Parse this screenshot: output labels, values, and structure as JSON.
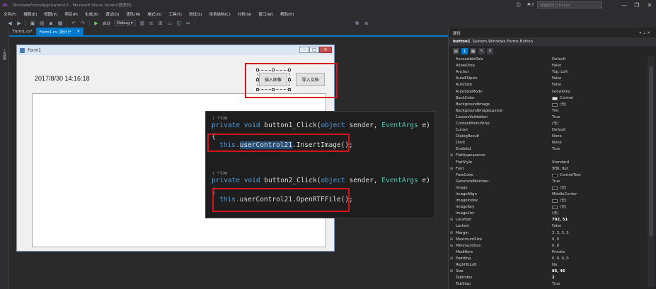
{
  "window": {
    "title": "WindowsFormsApplication13 - Microsoft Visual Studio(管理员)",
    "notify_count": "7",
    "quick_launch_placeholder": "快速启动 (Ctrl+Q)",
    "min": "—",
    "max": "❐",
    "close": "✕"
  },
  "menu": [
    "文件(F)",
    "编辑(E)",
    "视图(V)",
    "项目(P)",
    "生成(B)",
    "调试(D)",
    "团队(M)",
    "格式(O)",
    "工具(T)",
    "测试(S)",
    "体系结构(C)",
    "分析(N)",
    "窗口(W)",
    "帮助(H)"
  ],
  "toolbar": {
    "start_label": "启动",
    "config": "Debug"
  },
  "left_strip": "工具箱",
  "tabs": [
    {
      "label": "Form1.cs*",
      "active": false
    },
    {
      "label": "Form1.cs [设计]*",
      "active": true
    }
  ],
  "form": {
    "title": "Form1",
    "datetime": "2017/8/30 14:16:18",
    "btn_insert_image": "插入图像",
    "btn_import_doc": "导入文档"
  },
  "code": {
    "ref1": "1 个引用",
    "ref2": "1 个引用",
    "line1_kw": "private void",
    "line1_name": " button1_Click(",
    "line1_p1": "object",
    "line1_sender": " sender, ",
    "line1_p2": "EventArgs",
    "line1_end": " e)",
    "brace": "{",
    "l2_this": "this.",
    "l2_ctl": "userControl21",
    "l2_call": ".InsertImage();",
    "line3_kw": "private void",
    "line3_name": " button2_Click(",
    "line3_p1": "object",
    "line3_sender": " sender, ",
    "line3_p2": "EventArgs",
    "line3_end": " e)",
    "l4_this": "this.",
    "l4_ctl": "userControl21",
    "l4_call": ".OpenRTFFile();"
  },
  "properties": {
    "header": "属性",
    "object_name": "button1",
    "object_type": "System.Windows.Forms.Button",
    "rows": [
      {
        "name": "AccessibleRole",
        "value": "Default"
      },
      {
        "name": "AllowDrop",
        "value": "False"
      },
      {
        "name": "Anchor",
        "value": "Top, Left"
      },
      {
        "name": "AutoEllipsis",
        "value": "False"
      },
      {
        "name": "AutoSize",
        "value": "False"
      },
      {
        "name": "AutoSizeMode",
        "value": "GrowOnly"
      },
      {
        "name": "BackColor",
        "value": "Control",
        "swatch": "#f0f0f0"
      },
      {
        "name": "BackgroundImage",
        "value": "(无)",
        "swatch": "#1e1e1e"
      },
      {
        "name": "BackgroundImageLayout",
        "value": "Tile"
      },
      {
        "name": "CausesValidation",
        "value": "True"
      },
      {
        "name": "ContextMenuStrip",
        "value": "(无)"
      },
      {
        "name": "Cursor",
        "value": "Default"
      },
      {
        "name": "DialogResult",
        "value": "None"
      },
      {
        "name": "Dock",
        "value": "None"
      },
      {
        "name": "Enabled",
        "value": "True"
      },
      {
        "name": "FlatAppearance",
        "value": "",
        "exp": "⊞"
      },
      {
        "name": "FlatStyle",
        "value": "Standard"
      },
      {
        "name": "Font",
        "value": "宋体, 9pt",
        "exp": "⊞"
      },
      {
        "name": "ForeColor",
        "value": "ControlText",
        "swatch": "#000000"
      },
      {
        "name": "GenerateMember",
        "value": "True"
      },
      {
        "name": "Image",
        "value": "(无)",
        "swatch": "#1e1e1e"
      },
      {
        "name": "ImageAlign",
        "value": "MiddleCenter"
      },
      {
        "name": "ImageIndex",
        "value": "(无)",
        "swatch": "#1e1e1e"
      },
      {
        "name": "ImageKey",
        "value": "(无)",
        "swatch": "#1e1e1e"
      },
      {
        "name": "ImageList",
        "value": "(无)"
      },
      {
        "name": "Location",
        "value": "702, 51",
        "exp": "⊞",
        "bold": true
      },
      {
        "name": "Locked",
        "value": "False"
      },
      {
        "name": "Margin",
        "value": "3, 3, 3, 3",
        "exp": "⊞"
      },
      {
        "name": "MaximumSize",
        "value": "0, 0",
        "exp": "⊞"
      },
      {
        "name": "MinimumSize",
        "value": "0, 0",
        "exp": "⊞"
      },
      {
        "name": "Modifiers",
        "value": "Private"
      },
      {
        "name": "Padding",
        "value": "0, 0, 0, 0",
        "exp": "⊞"
      },
      {
        "name": "RightToLeft",
        "value": "No"
      },
      {
        "name": "Size",
        "value": "85, 46",
        "exp": "⊞",
        "bold": true
      },
      {
        "name": "TabIndex",
        "value": "2",
        "bold": true
      },
      {
        "name": "TabStop",
        "value": "True"
      }
    ]
  }
}
